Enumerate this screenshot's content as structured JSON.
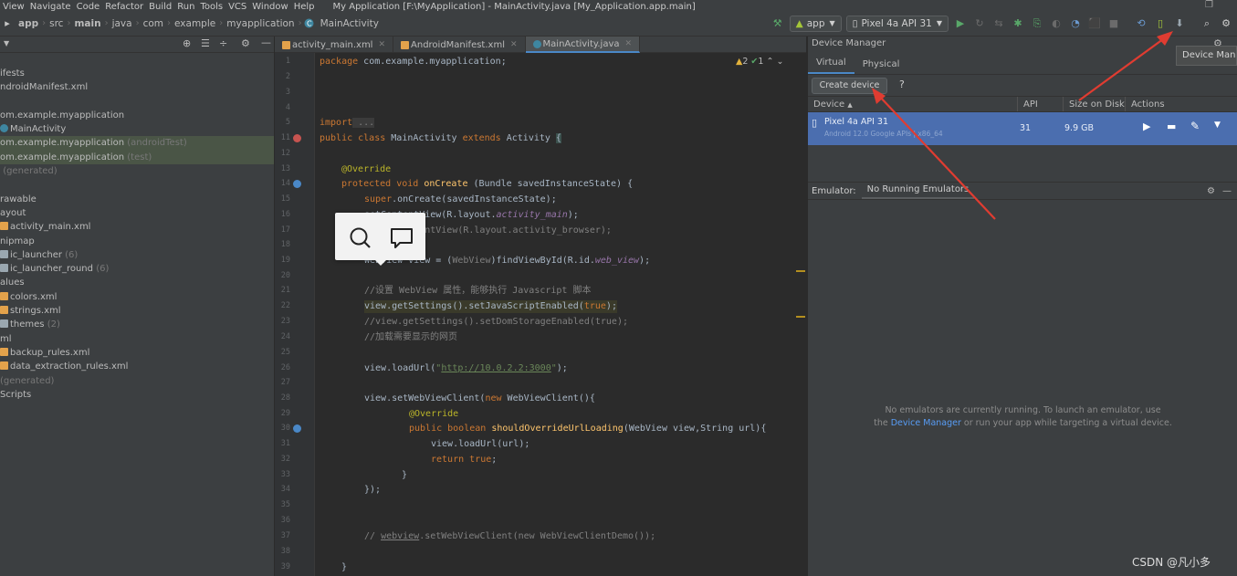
{
  "menu": [
    "View",
    "Navigate",
    "Code",
    "Refactor",
    "Build",
    "Run",
    "Tools",
    "VCS",
    "Window",
    "Help"
  ],
  "window_title": "My Application [F:\\MyApplication] - MainActivity.java [My_Application.app.main]",
  "breadcrumbs": [
    "app",
    "src",
    "main",
    "java",
    "com",
    "example",
    "myapplication",
    "MainActivity"
  ],
  "run_config": "app",
  "device_selector": "Pixel 4a API 31",
  "tree": [
    {
      "t": "ifests"
    },
    {
      "t": "ndroidManifest.xml"
    },
    {
      "t": ""
    },
    {
      "t": "om.example.myapplication"
    },
    {
      "t": "MainActivity"
    },
    {
      "t": "om.example.myapplication",
      "g": "(androidTest)"
    },
    {
      "t": "om.example.myapplication",
      "g": "(test)"
    },
    {
      "t": "",
      "g": "(generated)"
    },
    {
      "t": ""
    },
    {
      "t": "rawable"
    },
    {
      "t": "ayout"
    },
    {
      "t": "activity_main.xml"
    },
    {
      "t": "nipmap"
    },
    {
      "t": "ic_launcher",
      "g": "(6)"
    },
    {
      "t": "ic_launcher_round",
      "g": "(6)"
    },
    {
      "t": "alues"
    },
    {
      "t": "colors.xml"
    },
    {
      "t": "strings.xml"
    },
    {
      "t": "themes",
      "g": "(2)"
    },
    {
      "t": "ml"
    },
    {
      "t": "backup_rules.xml"
    },
    {
      "t": "data_extraction_rules.xml"
    },
    {
      "t": "",
      "g": "(generated)"
    },
    {
      "t": "Scripts"
    }
  ],
  "editor_tabs": [
    "activity_main.xml",
    "AndroidManifest.xml",
    "MainActivity.java"
  ],
  "inspections": {
    "warnings": "2",
    "weak": "1"
  },
  "line_numbers": [
    "1",
    "2",
    "3",
    "4",
    "5",
    "11",
    "12",
    "13",
    "14",
    "15",
    "16",
    "17",
    "18",
    "19",
    "20",
    "21",
    "22",
    "23",
    "24",
    "25",
    "26",
    "27",
    "28",
    "29",
    "30",
    "31",
    "32",
    "33",
    "34",
    "35",
    "36",
    "37",
    "38",
    "39"
  ],
  "code": {
    "package_kw": "package",
    "package_name": " com.example.myapplication;",
    "import_kw": "import",
    "import_fold": " ...",
    "l11_a": "public class ",
    "l11_b": "MainActivity ",
    "l11_c": "extends ",
    "l11_d": "Activity ",
    "l11_e": "{",
    "override1": "@Override",
    "l14_a": "protected void ",
    "l14_b": "onCreate ",
    "l14_c": "(Bundle savedInstanceState) {",
    "l15_a": "super",
    "l15_b": ".onCreate(savedInstanceState);",
    "l16_a": "setContentView(R.layout.",
    "l16_b": "activity_main",
    "l16_c": ");",
    "l17": "// setContentView(R.layout.activity_browser);",
    "l19_a": "WebView view = (",
    "l19_b": "WebView",
    "l19_c": ")findViewById(R.id.",
    "l19_d": "web_view",
    "l19_e": ");",
    "l21": "//设置 WebView 属性，能够执行 Javascript 脚本",
    "l22_a": "view.getSettings().setJavaScriptEnabled(",
    "l22_b": "true",
    "l22_c": ");",
    "l23": "//view.getSettings().setDomStorageEnabled(true);",
    "l24": "//加载需要显示的网页",
    "l26_a": "view.loadUrl(",
    "l26_q1": "\"",
    "l26_b": "http://10.0.2.2:3000",
    "l26_q2": "\"",
    "l26_c": ");",
    "l28_a": "view.setWebViewClient(",
    "l28_b": "new ",
    "l28_c": "WebViewClient(){",
    "override2": "@Override",
    "l30_a": "public boolean ",
    "l30_b": "shouldOverrideUrlLoading",
    "l30_c": "(WebView view,String url){",
    "l31": "view.loadUrl(url);",
    "l32_a": "return ",
    "l32_b": "true",
    "l32_c": ";",
    "l33": "}",
    "l34": "});",
    "l37_a": "// ",
    "l37_b": "webview",
    "l37_c": ".setWebViewClient(new WebViewClientDemo());",
    "l39": "}"
  },
  "device_manager": {
    "title": "Device Manager",
    "tabs": [
      "Virtual",
      "Physical"
    ],
    "create_button": "Create device",
    "help": "?",
    "columns": [
      "Device",
      "API",
      "Size on Disk",
      "Actions"
    ],
    "sort_arrow": "▲",
    "device": {
      "name": "Pixel 4a API 31",
      "subtitle": "Android 12.0 Google APIs | x86_64",
      "api": "31",
      "size": "9.9 GB"
    }
  },
  "emulator": {
    "label": "Emulator:",
    "tab": "No Running Emulators",
    "msg1": "No emulators are currently running. To launch an emulator, use",
    "msg2_pre": "the ",
    "msg2_link": "Device Manager",
    "msg2_post": " or run your app while targeting a virtual device."
  },
  "tooltip": "Device Manager",
  "watermark": "CSDN @凡小多",
  "colors": {
    "accent": "#4a88c7",
    "arrow": "#e03c31",
    "selection": "#4b6eaf"
  }
}
